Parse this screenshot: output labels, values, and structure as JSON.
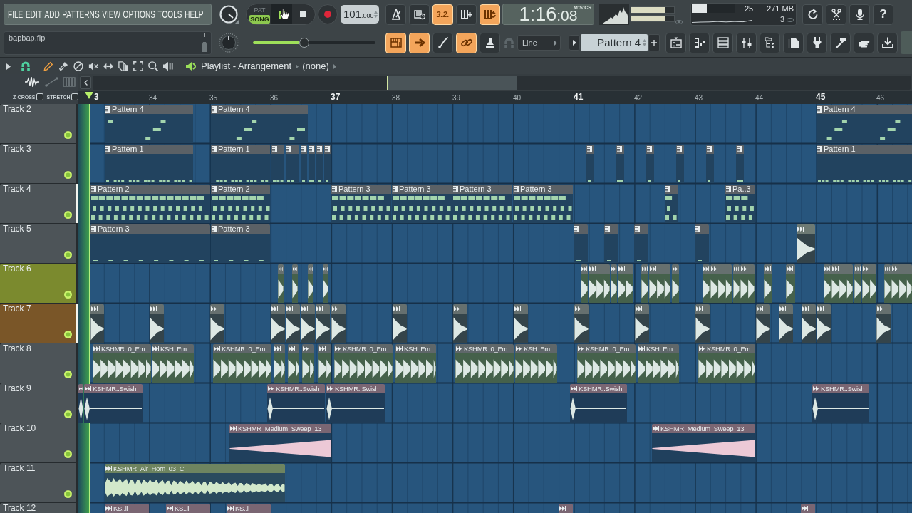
{
  "menu": [
    "FILE",
    "EDIT",
    "ADD",
    "PATTERNS",
    "VIEW",
    "OPTIONS",
    "TOOLS",
    "HELP"
  ],
  "hint_panel": {
    "filename": "bapbap.flp"
  },
  "transport": {
    "modes": [
      {
        "label": "PAT",
        "selected": false
      },
      {
        "label": "SONG",
        "selected": true
      }
    ],
    "playing": true
  },
  "tempo": {
    "whole": "101",
    "fraction": ".000"
  },
  "master_volume": {
    "level": 0.42
  },
  "toggles_top": [
    {
      "kind": "metronome",
      "on": false
    },
    {
      "kind": "keyboard-clock",
      "on": false
    },
    {
      "kind": "countdown",
      "label": "3.2.",
      "on": true
    },
    {
      "kind": "comb-plus",
      "on": false
    },
    {
      "kind": "comb-loop",
      "on": true
    }
  ],
  "toggles_bottom": [
    {
      "kind": "keyboard",
      "on": true
    },
    {
      "kind": "arrow",
      "on": true
    },
    {
      "kind": "brush",
      "on": false
    },
    {
      "kind": "link",
      "on": true
    },
    {
      "kind": "stamp",
      "on": false
    }
  ],
  "time": {
    "main": "1:16",
    "fraction": ":08",
    "format": "M:S:CS"
  },
  "output_meters": [
    {
      "level": 0.8
    },
    {
      "level": 0.8
    }
  ],
  "cpu": {
    "level": 0.35,
    "reading": "25"
  },
  "memory": "271 MB",
  "voices": "3",
  "help_button": "?",
  "snap": "Line",
  "pattern_selector": "Pattern 4",
  "playlist": {
    "tools": [
      {
        "kind": "pencil",
        "selected": true
      },
      {
        "kind": "paint",
        "selected": false
      },
      {
        "kind": "delete",
        "selected": false
      },
      {
        "kind": "mute",
        "selected": false
      },
      {
        "kind": "slip",
        "selected": false
      },
      {
        "kind": "slice",
        "selected": false
      },
      {
        "kind": "select",
        "selected": false
      },
      {
        "kind": "zoom",
        "selected": false
      },
      {
        "kind": "playback",
        "selected": false
      }
    ],
    "title": "Playlist - Arrangement",
    "arrangement": "(none)",
    "z_cross": {
      "label": "Z-CROSS",
      "checked": false
    },
    "stretch": {
      "label": "STRETCH",
      "checked": false
    },
    "ruler": [
      "3",
      "34",
      "35",
      "36",
      "37",
      "38",
      "39",
      "40",
      "41",
      "42",
      "43",
      "44",
      "45",
      "46"
    ],
    "tracks": [
      {
        "name": "Track 2",
        "color": "#4d5458",
        "selected": false,
        "enabled": true,
        "clips": [
          {
            "kind": "pattern",
            "label": "Pattern 4",
            "color": "#5b6166"
          },
          {
            "kind": "pattern",
            "label": "Pattern 4",
            "color": "#5b6166"
          },
          {
            "kind": "pattern",
            "label": "Pattern 4",
            "color": "#5b6166"
          }
        ]
      },
      {
        "name": "Track 3",
        "color": "#4d5458",
        "selected": false,
        "enabled": true,
        "clips": [
          {
            "kind": "pattern",
            "label": "Pattern 1",
            "color": "#5b6166"
          },
          {
            "kind": "pattern",
            "label": "Pattern 1",
            "color": "#5b6166"
          },
          {
            "kind": "pattern",
            "color": "#5b6166"
          },
          {
            "kind": "pattern",
            "color": "#5b6166"
          },
          {
            "kind": "pattern",
            "color": "#5b6166"
          },
          {
            "kind": "pattern",
            "color": "#5b6166"
          },
          {
            "kind": "pattern",
            "color": "#5b6166"
          },
          {
            "kind": "pattern",
            "color": "#5b6166"
          },
          {
            "kind": "pattern",
            "color": "#5b6166"
          },
          {
            "kind": "pattern",
            "color": "#5b6166"
          },
          {
            "kind": "pattern",
            "color": "#5b6166"
          },
          {
            "kind": "pattern",
            "color": "#5b6166"
          },
          {
            "kind": "pattern",
            "color": "#5b6166"
          },
          {
            "kind": "pattern",
            "color": "#5b6166"
          },
          {
            "kind": "pattern",
            "label": "Pattern 1",
            "color": "#5b6166"
          }
        ]
      },
      {
        "name": "Track 4",
        "color": "#4d5458",
        "selected": true,
        "enabled": true,
        "clips": [
          {
            "kind": "pattern",
            "label": "Pattern 2",
            "color": "#5b6166"
          },
          {
            "kind": "pattern",
            "label": "Pattern 2",
            "color": "#5b6166"
          },
          {
            "kind": "pattern",
            "label": "Pattern 3",
            "color": "#5b6166"
          },
          {
            "kind": "pattern",
            "label": "Pattern 3",
            "color": "#5b6166"
          },
          {
            "kind": "pattern",
            "label": "Pattern 3",
            "color": "#5b6166"
          },
          {
            "kind": "pattern",
            "label": "Pattern 3",
            "color": "#5b6166"
          },
          {
            "kind": "pattern",
            "color": "#5b6166"
          },
          {
            "kind": "pattern",
            "label": "Pa..3",
            "color": "#5b6166"
          }
        ]
      },
      {
        "name": "Track 5",
        "color": "#4d5458",
        "selected": false,
        "enabled": true,
        "clips": [
          {
            "kind": "pattern",
            "label": "Pattern 3",
            "color": "#5b6166"
          },
          {
            "kind": "pattern",
            "label": "Pattern 3",
            "color": "#5b6166"
          },
          {
            "kind": "pattern",
            "color": "#5b6166"
          },
          {
            "kind": "pattern",
            "color": "#5b6166"
          },
          {
            "kind": "pattern",
            "color": "#5b6166"
          },
          {
            "kind": "pattern",
            "color": "#5b6166"
          },
          {
            "kind": "audio",
            "color": "#6d7a74"
          }
        ]
      },
      {
        "name": "Track 6",
        "color": "#7b8a2e",
        "selected": false,
        "enabled": true,
        "clips": [
          {
            "kind": "audio",
            "color": "#66706f"
          },
          {
            "kind": "audio",
            "color": "#66706f"
          },
          {
            "kind": "audio",
            "color": "#66706f"
          },
          {
            "kind": "audio",
            "color": "#66706f"
          },
          {
            "kind": "audio",
            "color": "#66706f"
          },
          {
            "kind": "audio",
            "color": "#66706f"
          },
          {
            "kind": "audio",
            "color": "#66706f"
          },
          {
            "kind": "audio",
            "color": "#66706f"
          },
          {
            "kind": "audio",
            "color": "#66706f"
          },
          {
            "kind": "audio",
            "color": "#66706f"
          },
          {
            "kind": "audio",
            "color": "#66706f"
          },
          {
            "kind": "audio",
            "color": "#66706f"
          },
          {
            "kind": "audio",
            "color": "#66706f"
          },
          {
            "kind": "audio",
            "color": "#66706f"
          },
          {
            "kind": "audio",
            "color": "#66706f"
          },
          {
            "kind": "audio",
            "color": "#66706f"
          },
          {
            "kind": "audio",
            "color": "#66706f"
          },
          {
            "kind": "audio",
            "color": "#66706f"
          },
          {
            "kind": "audio",
            "color": "#66706f"
          },
          {
            "kind": "audio",
            "color": "#66706f"
          },
          {
            "kind": "audio",
            "color": "#66706f"
          },
          {
            "kind": "audio",
            "color": "#66706f"
          },
          {
            "kind": "audio",
            "color": "#66706f"
          }
        ]
      },
      {
        "name": "Track 7",
        "color": "#7a5628",
        "selected": true,
        "enabled": true,
        "clips": [
          {
            "kind": "audio",
            "color": "#66706f"
          },
          {
            "kind": "audio",
            "color": "#66706f"
          },
          {
            "kind": "audio",
            "color": "#66706f"
          },
          {
            "kind": "audio",
            "color": "#66706f"
          },
          {
            "kind": "audio",
            "color": "#66706f"
          },
          {
            "kind": "audio",
            "color": "#66706f"
          },
          {
            "kind": "audio",
            "color": "#66706f"
          },
          {
            "kind": "audio",
            "color": "#66706f"
          },
          {
            "kind": "audio",
            "color": "#66706f"
          },
          {
            "kind": "audio",
            "color": "#66706f"
          },
          {
            "kind": "audio",
            "color": "#66706f"
          },
          {
            "kind": "audio",
            "color": "#66706f"
          },
          {
            "kind": "audio",
            "color": "#66706f"
          },
          {
            "kind": "audio",
            "color": "#66706f"
          },
          {
            "kind": "audio",
            "color": "#66706f"
          },
          {
            "kind": "audio",
            "color": "#66706f"
          },
          {
            "kind": "audio",
            "color": "#66706f"
          },
          {
            "kind": "audio",
            "color": "#66706f"
          },
          {
            "kind": "audio",
            "color": "#66706f"
          }
        ]
      },
      {
        "name": "Track 8",
        "color": "#4d5458",
        "selected": false,
        "enabled": true,
        "clips": [
          {
            "kind": "audio",
            "label": "KSHMR..0_Em",
            "color": "#5f676a"
          },
          {
            "kind": "audio",
            "label": "KSH..Em",
            "color": "#5f676a"
          },
          {
            "kind": "audio",
            "label": "KSHMR..0_Em",
            "color": "#5f676a"
          },
          {
            "kind": "audio",
            "color": "#5f676a"
          },
          {
            "kind": "audio",
            "color": "#5f676a"
          },
          {
            "kind": "audio",
            "color": "#5f676a"
          },
          {
            "kind": "audio",
            "color": "#5f676a"
          },
          {
            "kind": "audio",
            "label": "KSHMR..0_Em",
            "color": "#5f676a"
          },
          {
            "kind": "audio",
            "label": "KSH..Em",
            "color": "#5f676a"
          },
          {
            "kind": "audio",
            "label": "KSHMR..0_Em",
            "color": "#5f676a"
          },
          {
            "kind": "audio",
            "label": "KSH..Em",
            "color": "#5f676a"
          },
          {
            "kind": "audio",
            "label": "KSHMR..0_Em",
            "color": "#5f676a"
          },
          {
            "kind": "audio",
            "label": "KSH..Em",
            "color": "#5f676a"
          },
          {
            "kind": "audio",
            "label": "KSHMR..0_Em",
            "color": "#5f676a"
          }
        ]
      },
      {
        "name": "Track 9",
        "color": "#4d5458",
        "selected": false,
        "enabled": true,
        "clips": [
          {
            "kind": "audio",
            "color": "#7a6673"
          },
          {
            "kind": "audio",
            "label": "KSHMR..Swish",
            "color": "#7a6673"
          },
          {
            "kind": "audio",
            "label": "KSHMR..Swish",
            "color": "#7a6673"
          },
          {
            "kind": "audio",
            "label": "KSHMR..Swish",
            "color": "#7a6673"
          },
          {
            "kind": "audio",
            "label": "KSHMR..Swish",
            "color": "#7a6673"
          },
          {
            "kind": "audio",
            "label": "KSHMR..Swish",
            "color": "#7a6673"
          }
        ]
      },
      {
        "name": "Track 10",
        "color": "#4d5458",
        "selected": false,
        "enabled": true,
        "clips": [
          {
            "kind": "audio",
            "label": "KSHMR_Medium_Sweep_13",
            "color": "#7a6673"
          },
          {
            "kind": "audio",
            "label": "KSHMR_Medium_Sweep_13",
            "color": "#7a6673"
          }
        ]
      },
      {
        "name": "Track 11",
        "color": "#4d5458",
        "selected": false,
        "enabled": true,
        "clips": [
          {
            "kind": "audio",
            "label": "KSHMR_Air_Horn_03_C",
            "color": "#6e8460"
          }
        ]
      },
      {
        "name": "Track 12",
        "color": "#4d5458",
        "selected": false,
        "clips": [
          {
            "kind": "audio",
            "label": "KS..ll",
            "color": "#7a6673"
          },
          {
            "kind": "audio",
            "label": "KS..ll",
            "color": "#7a6673"
          },
          {
            "kind": "audio",
            "label": "KS..ll",
            "color": "#7a6673"
          },
          {
            "kind": "audio",
            "color": "#7a6673"
          },
          {
            "kind": "audio",
            "color": "#7a6673"
          }
        ]
      }
    ]
  }
}
